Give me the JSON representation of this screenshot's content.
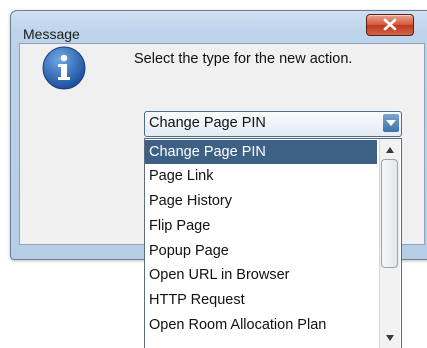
{
  "window": {
    "title": "Message"
  },
  "dialog": {
    "prompt": "Select the type for the new action.",
    "icon": "information-icon"
  },
  "combo": {
    "selected": "Change Page PIN"
  },
  "dropdown": {
    "items": [
      "Change Page PIN",
      "Page Link",
      "Page History",
      "Flip Page",
      "Popup Page",
      "Open URL in Browser",
      "HTTP Request",
      "Open Room Allocation Plan"
    ],
    "selected_index": 0
  },
  "colors": {
    "selection": "#3d6185",
    "close_button": "#c0381b",
    "info_icon": "#1f5fb0"
  }
}
